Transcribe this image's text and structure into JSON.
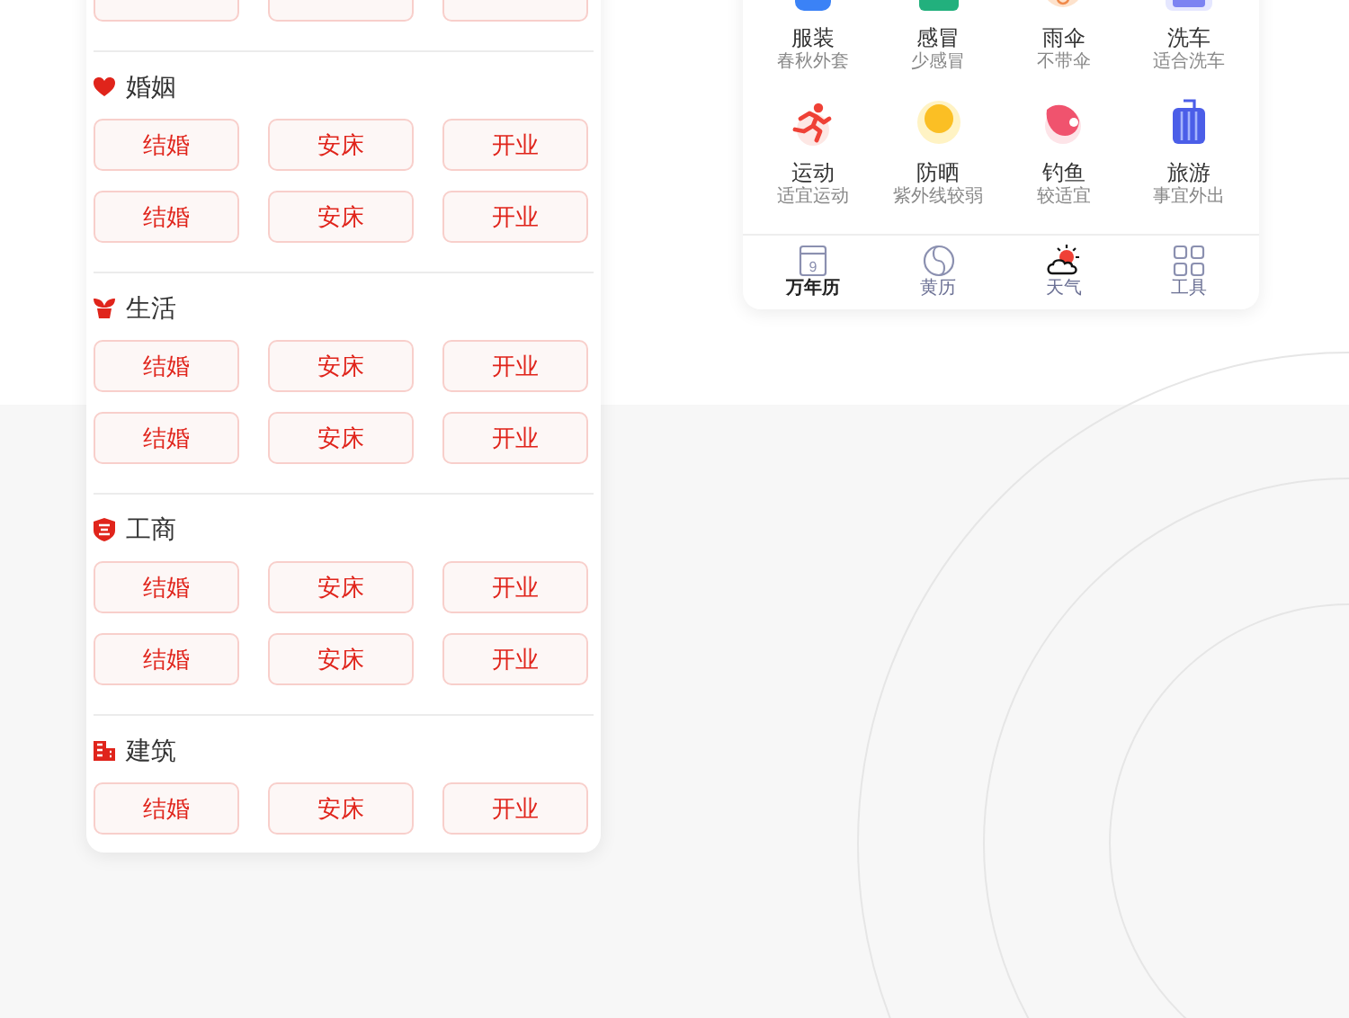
{
  "left_card": {
    "sections": [
      {
        "title": "婚姻",
        "rows": [
          [
            "结婚",
            "安床",
            "开业"
          ],
          [
            "结婚",
            "安床",
            "开业"
          ]
        ]
      },
      {
        "title": "生活",
        "rows": [
          [
            "结婚",
            "安床",
            "开业"
          ],
          [
            "结婚",
            "安床",
            "开业"
          ]
        ]
      },
      {
        "title": "工商",
        "rows": [
          [
            "结婚",
            "安床",
            "开业"
          ],
          [
            "结婚",
            "安床",
            "开业"
          ]
        ]
      },
      {
        "title": "建筑",
        "rows": [
          [
            "结婚",
            "安床",
            "开业"
          ]
        ]
      }
    ]
  },
  "right_card": {
    "items": [
      {
        "title": "服装",
        "sub": "春秋外套"
      },
      {
        "title": "感冒",
        "sub": "少感冒"
      },
      {
        "title": "雨伞",
        "sub": "不带伞"
      },
      {
        "title": "洗车",
        "sub": "适合洗车"
      },
      {
        "title": "运动",
        "sub": "适宜运动"
      },
      {
        "title": "防晒",
        "sub": "紫外线较弱"
      },
      {
        "title": "钓鱼",
        "sub": "较适宜"
      },
      {
        "title": "旅游",
        "sub": "事宜外出"
      }
    ],
    "tabs": [
      {
        "label": "万年历",
        "selected": true,
        "day": "9"
      },
      {
        "label": "黄历",
        "selected": false
      },
      {
        "label": "天气",
        "selected": false
      },
      {
        "label": "工具",
        "selected": false
      }
    ]
  }
}
